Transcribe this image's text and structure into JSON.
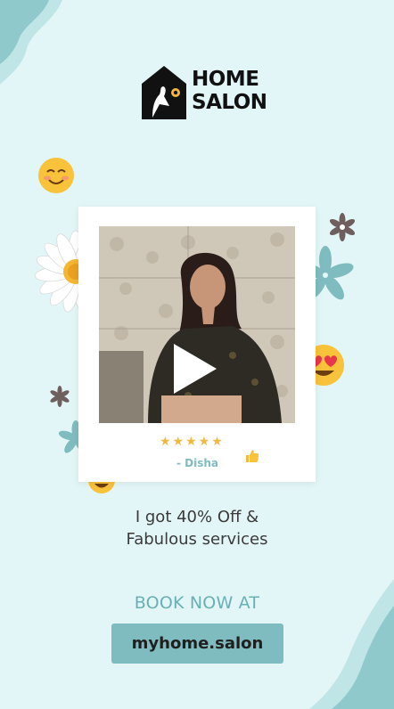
{
  "brand": {
    "name_line1": "HOME",
    "name_line2": "SALON"
  },
  "testimonial": {
    "stars": "★★★★★",
    "reviewer": "- Disha",
    "quote_line1": "I got 40% Off &",
    "quote_line2": "Fabulous services"
  },
  "cta": {
    "label": "BOOK NOW AT",
    "url_text": "myhome.salon"
  },
  "colors": {
    "background": "#e3f6f7",
    "accent_teal": "#7fbcc0",
    "dark_teal": "#69b0b4",
    "star_gold": "#f2b840"
  },
  "emojis": {
    "smiling": "☺",
    "heart_eyes": "😍",
    "star_struck": "🤩",
    "thumbs_up": "👍"
  }
}
